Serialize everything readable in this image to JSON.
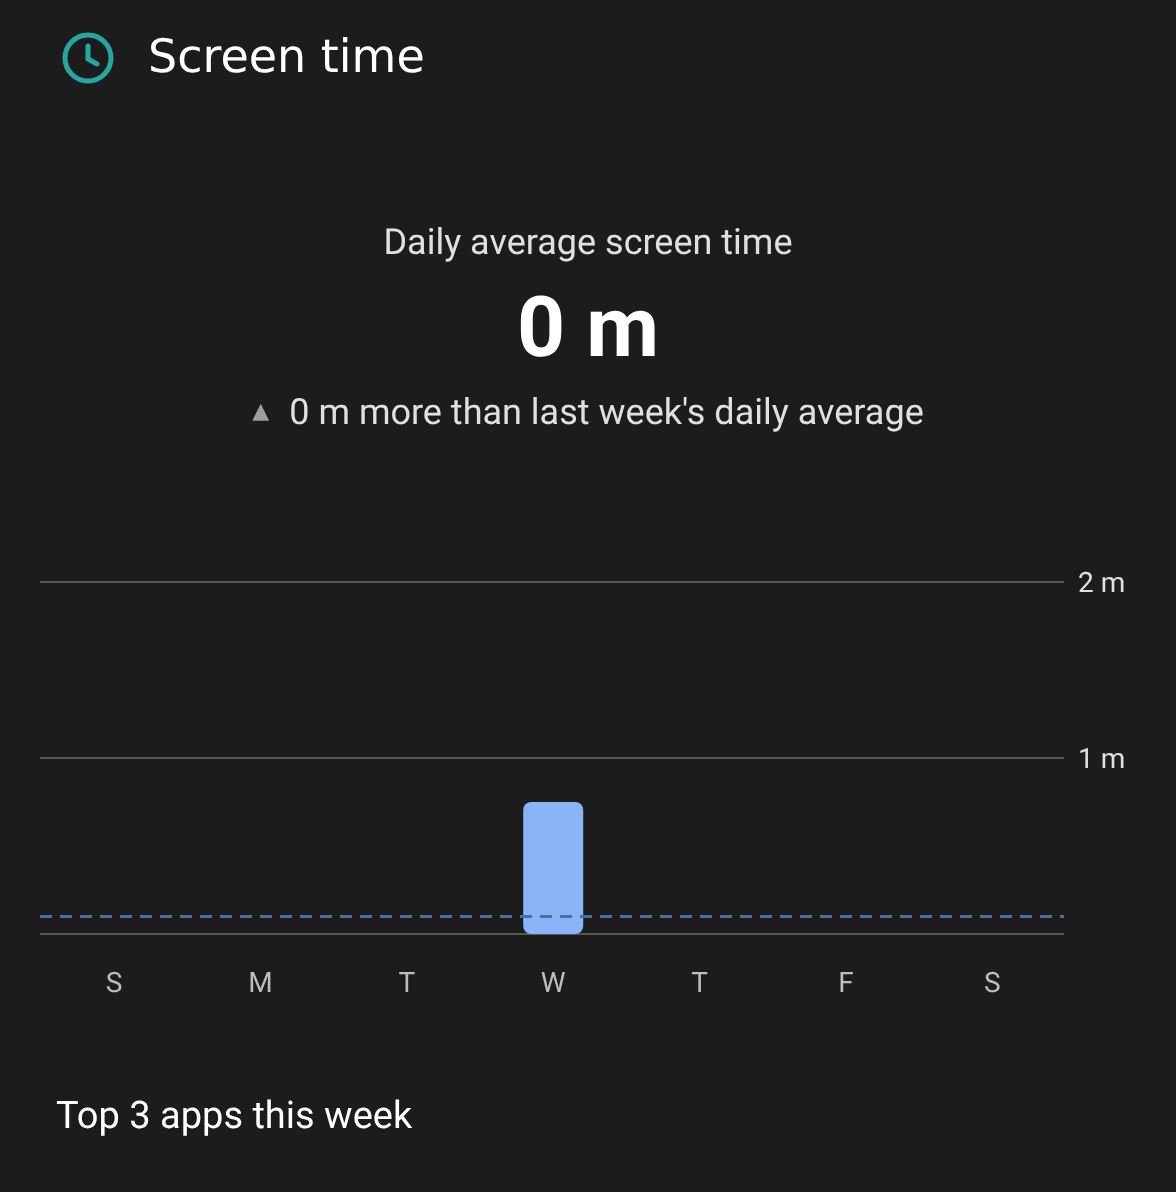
{
  "header": {
    "title": "Screen time"
  },
  "summary": {
    "label": "Daily average screen time",
    "value": "0 m",
    "change_icon": "▲",
    "change": "0 m more than last week's daily average"
  },
  "chart_data": {
    "type": "bar",
    "categories": [
      "S",
      "M",
      "T",
      "W",
      "T",
      "F",
      "S"
    ],
    "series": [
      {
        "color": "#8ab4f8",
        "values": [
          0,
          0,
          0,
          0.75,
          0,
          0,
          0
        ]
      }
    ],
    "ylim": [
      0,
      2
    ],
    "yticks": [
      {
        "value": 1,
        "label": "1 m"
      },
      {
        "value": 2,
        "label": "2 m"
      }
    ],
    "ref_lines": [
      {
        "axis": "y",
        "value": 0.1,
        "color": "#4a6fa5"
      }
    ]
  },
  "section": {
    "title": "Top 3 apps this week"
  }
}
